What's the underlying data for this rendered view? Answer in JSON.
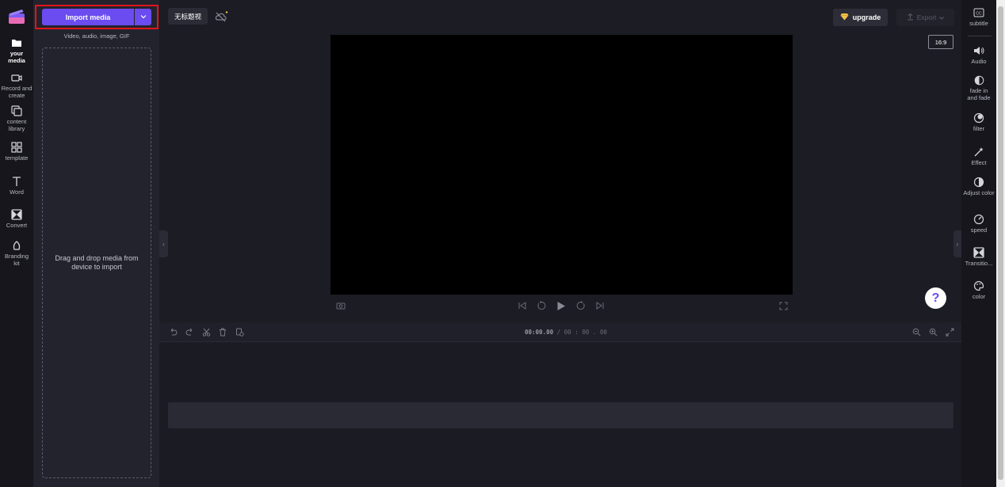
{
  "left_nav": [
    {
      "label": "your media",
      "icon": "folder-icon",
      "active": true
    },
    {
      "label": "Record and create",
      "icon": "camera-icon"
    },
    {
      "label": "content library",
      "icon": "library-icon"
    },
    {
      "label": "template",
      "icon": "template-icon"
    },
    {
      "label": "Word",
      "icon": "text-icon"
    },
    {
      "label": "Convert",
      "icon": "transition-icon"
    },
    {
      "label": "Branding kit",
      "icon": "brand-icon"
    }
  ],
  "media_panel": {
    "import_label": "Import media",
    "import_subtitle": "Video, audio, image, GIF",
    "drop_text": "Drag and drop media from device to import"
  },
  "topbar": {
    "project_name": "无标题视",
    "upgrade_label": "upgrade",
    "export_label": "Export",
    "aspect_ratio": "16:9"
  },
  "timeline": {
    "current_time": "00:00.00",
    "total_time": " / 00 : 00 . 00"
  },
  "help_label": "?",
  "right_nav": [
    {
      "label": "subtitle",
      "icon": "cc-icon"
    },
    {
      "label": "Audio",
      "icon": "speaker-icon"
    },
    {
      "label": "fade in and fade",
      "icon": "fade-icon"
    },
    {
      "label": "filter",
      "icon": "filter-icon"
    },
    {
      "label": "Effect",
      "icon": "magic-wand-icon"
    },
    {
      "label": "Adjust color",
      "icon": "contrast-icon"
    },
    {
      "label": "speed",
      "icon": "speedometer-icon"
    },
    {
      "label": "Transitio...",
      "icon": "transition-icon"
    },
    {
      "label": "color",
      "icon": "palette-icon"
    }
  ],
  "colors": {
    "accent": "#6a4cf0",
    "highlight": "#e0151c",
    "background": "#1c1c24"
  }
}
